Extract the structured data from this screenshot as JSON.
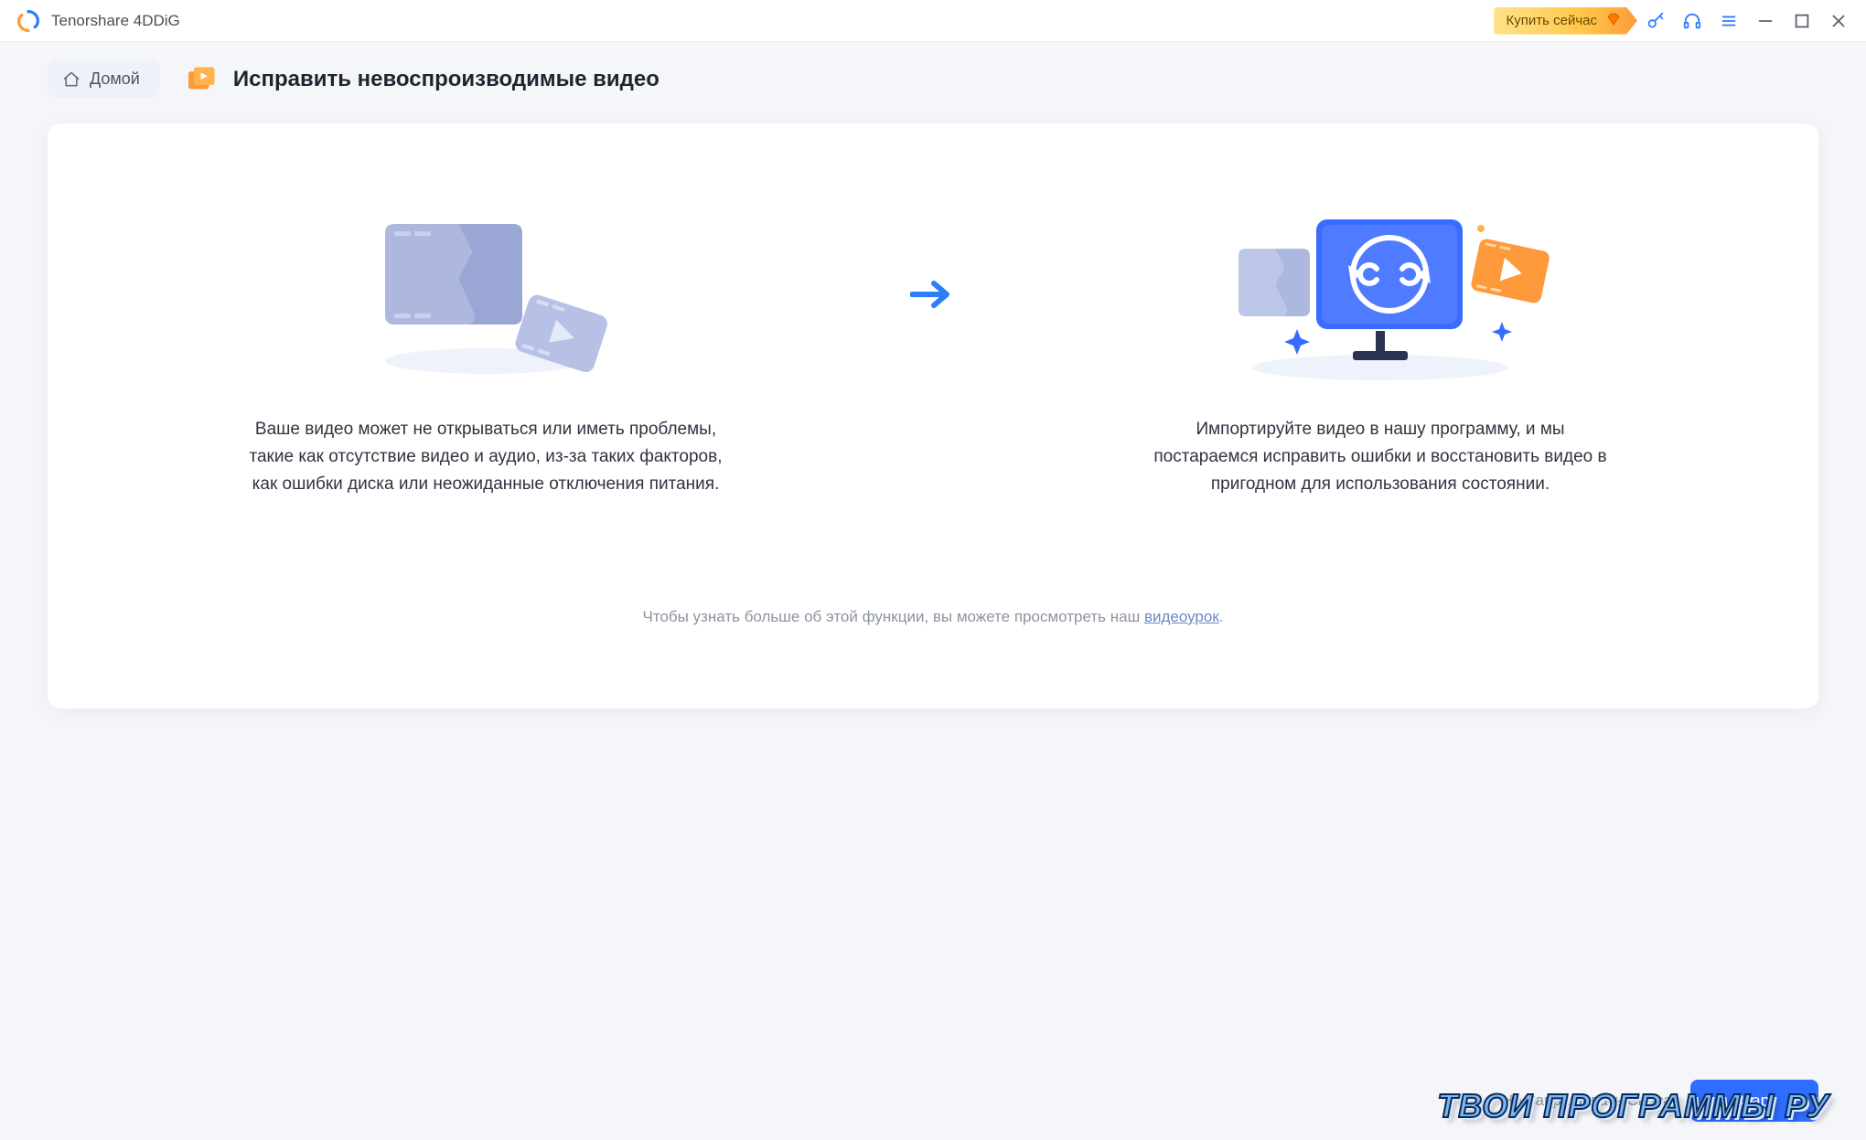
{
  "app": {
    "title": "Tenorshare 4DDiG",
    "buy_now": "Купить сейчас"
  },
  "header": {
    "home_label": "Домой",
    "section_title": "Исправить невоспроизводимые видео"
  },
  "panels": {
    "left_text": "Ваше видео может не открываться или иметь проблемы, такие как отсутствие видео и аудио, из-за таких факторов, как ошибки диска или неожиданные отключения питания.",
    "right_text": "Импортируйте видео в нашу программу, и мы постараемся исправить ошибки и восстановить видео в пригодном для использования состоянии."
  },
  "hint": {
    "prefix": "Чтобы узнать больше об этой функции, вы можете просмотреть наш ",
    "link": "видеоурок",
    "suffix": "."
  },
  "footer": {
    "no_prompt": "Не Запрашивать Снова",
    "primary": "Старт"
  },
  "watermark": "ТВОИ ПРОГРАММЫ РУ"
}
